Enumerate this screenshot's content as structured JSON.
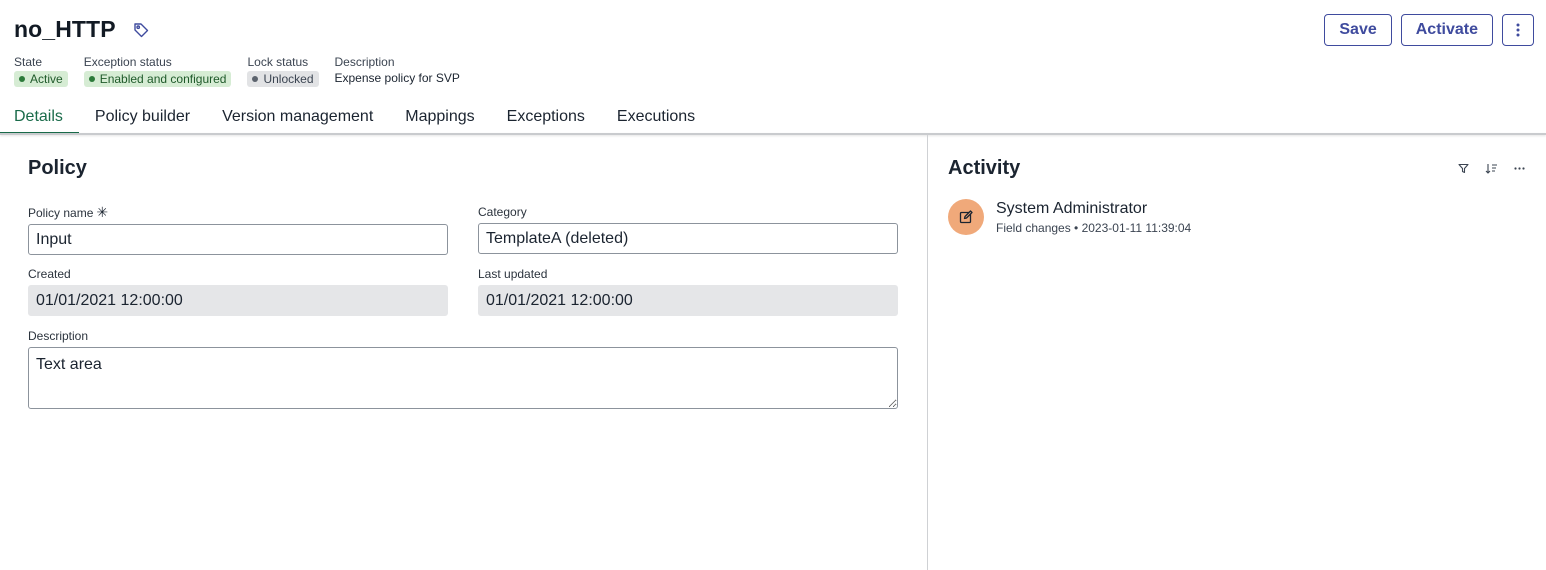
{
  "record": {
    "title": "no_HTTP",
    "tag_icon": "tag-icon"
  },
  "meta": {
    "state_label": "State",
    "state_value": "Active",
    "exception_label": "Exception status",
    "exception_value": "Enabled and configured",
    "lock_label": "Lock status",
    "lock_value": "Unlocked",
    "description_label": "Description",
    "description_value": "Expense policy for SVP",
    "colors": {
      "green_pill": "#d6ecd4",
      "gray_pill": "#e2e3e5"
    }
  },
  "actions": {
    "save_label": "Save",
    "activate_label": "Activate",
    "more_icon": "more-vertical-icon"
  },
  "tabs": [
    {
      "label": "Details",
      "active": true
    },
    {
      "label": "Policy builder"
    },
    {
      "label": "Version management"
    },
    {
      "label": "Mappings"
    },
    {
      "label": "Exceptions"
    },
    {
      "label": "Executions"
    }
  ],
  "policy": {
    "section_title": "Policy",
    "name_label": "Policy name",
    "name_value": "Input",
    "category_label": "Category",
    "category_value": "TemplateA (deleted)",
    "created_label": "Created",
    "created_value": "01/01/2021 12:00:00",
    "updated_label": "Last updated",
    "updated_value": "01/01/2021 12:00:00",
    "description_label": "Description",
    "description_value": "Text area"
  },
  "activity": {
    "title": "Activity",
    "entry": {
      "name": "System Administrator",
      "detail": "Field changes • 2023-01-11 11:39:04",
      "avatar_icon": "edit-icon",
      "avatar_color": "#f0a97a"
    }
  },
  "theme": {
    "accent": "#3f4b9e",
    "tab_active": "#1a6b4a"
  }
}
